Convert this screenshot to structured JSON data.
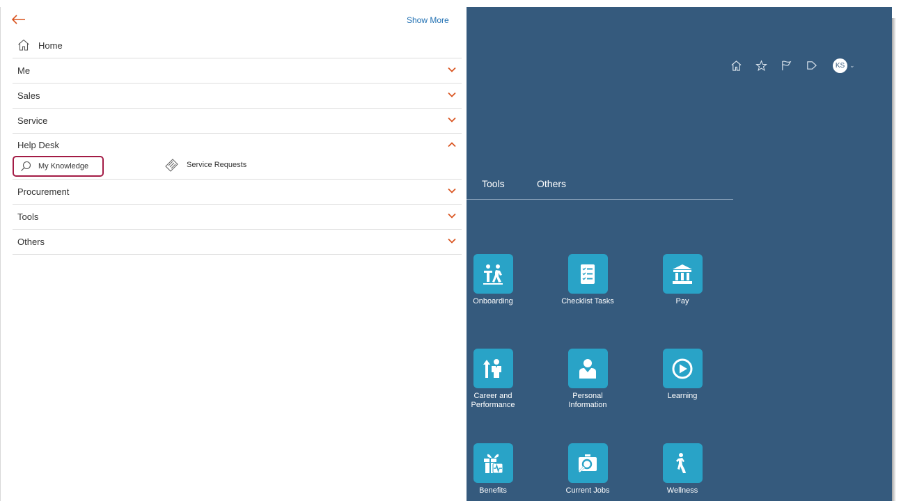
{
  "navigator": {
    "show_more": "Show More",
    "home": "Home",
    "groups": [
      {
        "label": "Me",
        "expanded": false
      },
      {
        "label": "Sales",
        "expanded": false
      },
      {
        "label": "Service",
        "expanded": false
      },
      {
        "label": "Help Desk",
        "expanded": true,
        "items": [
          "My Knowledge",
          "Service Requests"
        ]
      },
      {
        "label": "Procurement",
        "expanded": false
      },
      {
        "label": "Tools",
        "expanded": false
      },
      {
        "label": "Others",
        "expanded": false
      }
    ]
  },
  "header": {
    "icons": [
      "home-icon",
      "star-icon",
      "flag-icon",
      "notification-icon"
    ],
    "user_initials": "KS"
  },
  "tabs": [
    "Tools",
    "Others"
  ],
  "tiles": [
    {
      "label": "Onboarding",
      "icon": "onboarding-icon"
    },
    {
      "label": "Checklist Tasks",
      "icon": "checklist-icon"
    },
    {
      "label": "Pay",
      "icon": "bank-icon"
    },
    {
      "label": "Career and\nPerformance",
      "icon": "career-icon"
    },
    {
      "label": "Personal\nInformation",
      "icon": "person-icon"
    },
    {
      "label": "Learning",
      "icon": "play-icon"
    },
    {
      "label": "Benefits",
      "icon": "gift-icon"
    },
    {
      "label": "Current Jobs",
      "icon": "job-search-icon"
    },
    {
      "label": "Wellness",
      "icon": "wellness-icon"
    }
  ],
  "colors": {
    "app_background": "#355a7d",
    "tile": "#29a3c7",
    "accent_orange": "#d9531e",
    "link_blue": "#1f6fb2",
    "highlight": "#a31b45"
  }
}
